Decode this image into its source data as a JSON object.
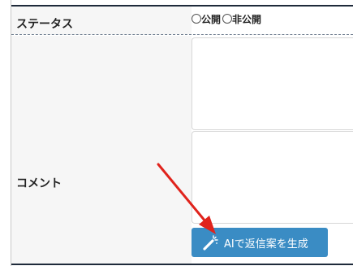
{
  "form": {
    "status_label": "ステータス",
    "status_options": [
      {
        "label": "公開"
      },
      {
        "label": "非公開"
      }
    ],
    "comment_label": "コメント",
    "generate_button_label": "AIで返信案を生成"
  },
  "colors": {
    "accent_button": "#3a8cc4",
    "annotation_arrow": "#e0231c",
    "table_rule": "#1e2a3a"
  },
  "icons": {
    "generate_button_icon": "magic-wand-icon"
  }
}
